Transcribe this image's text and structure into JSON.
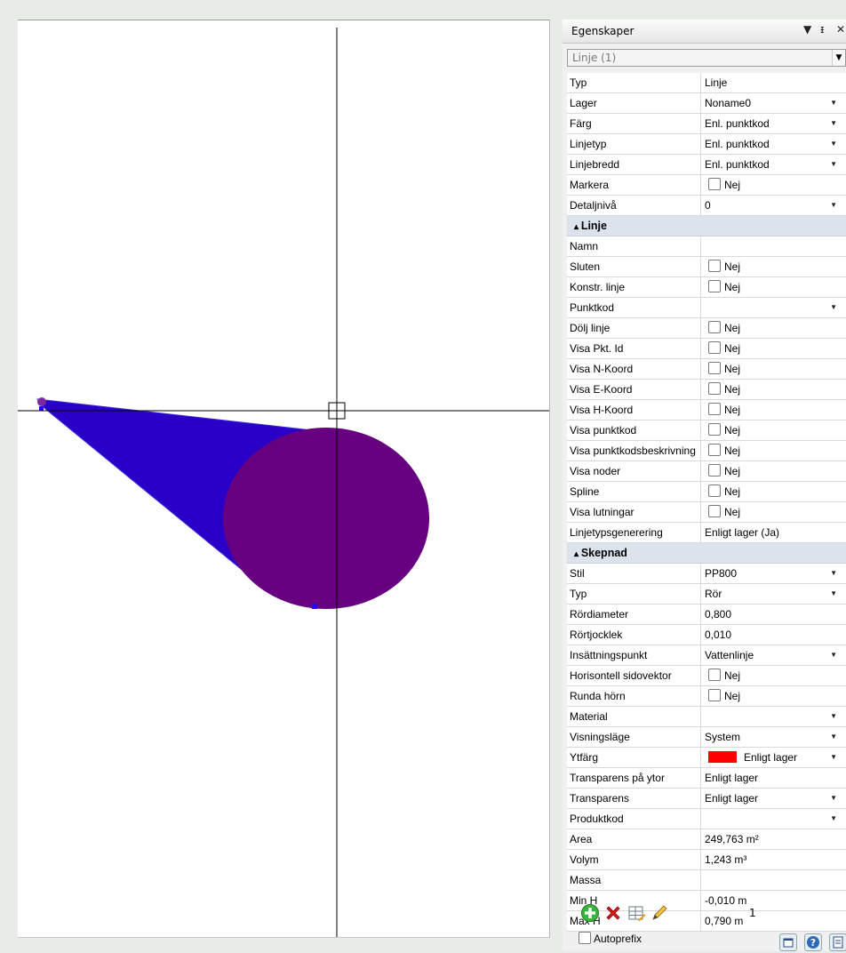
{
  "panel": {
    "title": "Egenskaper",
    "title_controls": [
      "▼",
      "ᵻ",
      "✕"
    ],
    "selector_value": "Linje (1)"
  },
  "rows_top": [
    {
      "k": "Typ",
      "v": "Linje",
      "dd": false
    },
    {
      "k": "Lager",
      "v": "Noname0",
      "dd": true
    },
    {
      "k": "Färg",
      "v": "Enl. punktkod",
      "dd": true
    },
    {
      "k": "Linjetyp",
      "v": "Enl. punktkod",
      "dd": true
    },
    {
      "k": "Linjebredd",
      "v": "Enl. punktkod",
      "dd": true
    },
    {
      "k": "Markera",
      "v": "Nej",
      "cb": true
    },
    {
      "k": "Detaljnivå",
      "v": "0",
      "dd": true
    }
  ],
  "section_linje": "Linje",
  "rows_linje": [
    {
      "k": "Namn",
      "v": ""
    },
    {
      "k": "Sluten",
      "v": "Nej",
      "cb": true
    },
    {
      "k": "Konstr. linje",
      "v": "Nej",
      "cb": true
    },
    {
      "k": "Punktkod",
      "v": "",
      "dd": true
    },
    {
      "k": "Dölj linje",
      "v": "Nej",
      "cb": true
    },
    {
      "k": "Visa Pkt. Id",
      "v": "Nej",
      "cb": true
    },
    {
      "k": "Visa N-Koord",
      "v": "Nej",
      "cb": true
    },
    {
      "k": "Visa E-Koord",
      "v": "Nej",
      "cb": true
    },
    {
      "k": "Visa H-Koord",
      "v": "Nej",
      "cb": true
    },
    {
      "k": "Visa punktkod",
      "v": "Nej",
      "cb": true
    },
    {
      "k": "Visa punktkodsbeskrivning",
      "v": "Nej",
      "cb": true
    },
    {
      "k": "Visa noder",
      "v": "Nej",
      "cb": true
    },
    {
      "k": "Spline",
      "v": "Nej",
      "cb": true
    },
    {
      "k": "Visa lutningar",
      "v": "Nej",
      "cb": true
    },
    {
      "k": "Linjetypsgenerering",
      "v": "Enligt lager (Ja)"
    }
  ],
  "section_skepnad": "Skepnad",
  "rows_skepnad": [
    {
      "k": "Stil",
      "v": "PP800",
      "dd": true
    },
    {
      "k": "Typ",
      "v": "Rör",
      "dd": true
    },
    {
      "k": "Rördiameter",
      "v": "0,800"
    },
    {
      "k": "Rörtjocklek",
      "v": "0,010"
    },
    {
      "k": "Insättningspunkt",
      "v": "Vattenlinje",
      "dd": true
    },
    {
      "k": "Horisontell sidovektor",
      "v": "Nej",
      "cb": true
    },
    {
      "k": "Runda hörn",
      "v": "Nej",
      "cb": true
    },
    {
      "k": "Material",
      "v": "",
      "dd": true
    },
    {
      "k": "Visningsläge",
      "v": "System",
      "dd": true
    },
    {
      "k": "Ytfärg",
      "v": "Enligt lager",
      "dd": true,
      "swatch": "#ff0000"
    },
    {
      "k": "Transparens på ytor",
      "v": "Enligt lager"
    },
    {
      "k": "Transparens",
      "v": "Enligt lager",
      "dd": true
    },
    {
      "k": "Produktkod",
      "v": "",
      "dd": true
    },
    {
      "k": "Area",
      "v": "249,763 m²"
    },
    {
      "k": "Volym",
      "v": "1,243 m³"
    },
    {
      "k": "Massa",
      "v": ""
    },
    {
      "k": "Min H",
      "v": "-0,010 m"
    },
    {
      "k": "Max H",
      "v": "0,790 m"
    }
  ],
  "toolbar": {
    "count": "1",
    "autoprefix_label": "Autoprefix"
  },
  "colors": {
    "cone": "#2a00c8",
    "ellipse": "#660080",
    "accent_red": "#ff0000"
  }
}
